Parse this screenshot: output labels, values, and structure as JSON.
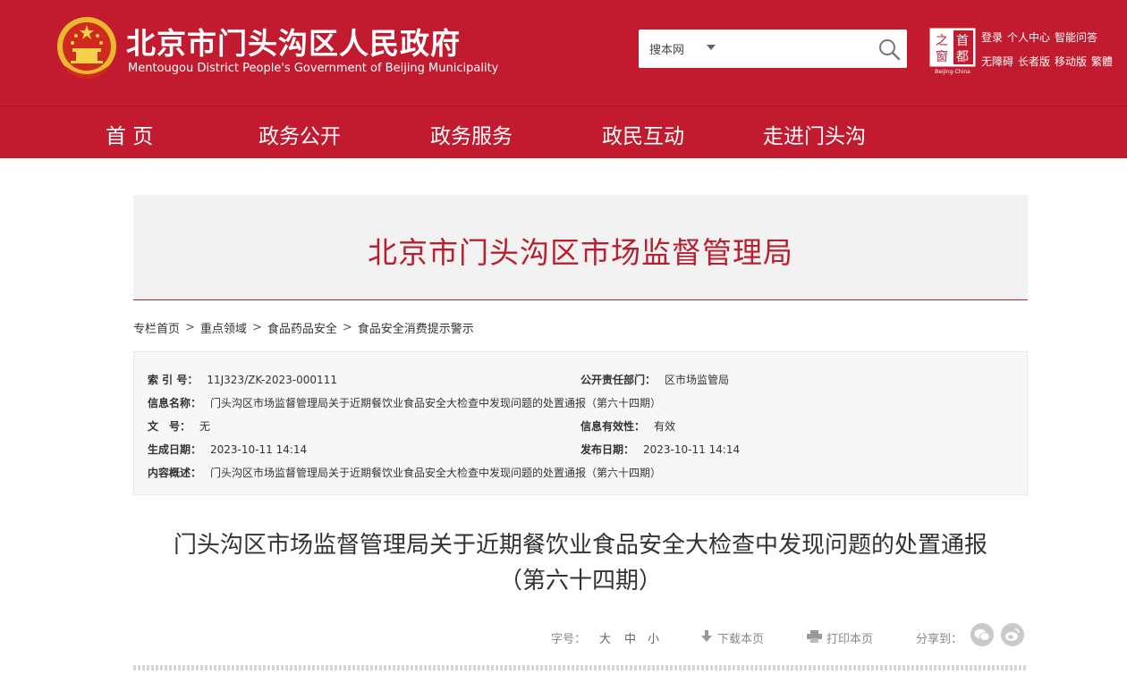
{
  "header": {
    "title": "北京市门头沟区人民政府",
    "subtitle": "Mentougou District People's Government of Beijing Municipality",
    "search": {
      "scope": "搜本网",
      "placeholder": ""
    },
    "capital_logo": {
      "chars": [
        "之",
        "首",
        "窗",
        "都"
      ],
      "caption": "Beijing-China"
    },
    "top_links": {
      "row1": [
        "登录",
        "个人中心",
        "智能问答"
      ],
      "row2": [
        "无障碍",
        "长者版",
        "移动版",
        "繁體"
      ]
    }
  },
  "nav": [
    "首 页",
    "政务公开",
    "政务服务",
    "政民互动",
    "走进门头沟"
  ],
  "department": "北京市门头沟区市场监督管理局",
  "breadcrumb": [
    "专栏首页",
    "重点领域",
    "食品药品安全",
    "食品安全消费提示警示"
  ],
  "breadcrumb_separator": ">",
  "info": {
    "index_label": "索 引 号：",
    "index_value": "11J323/ZK-2023-000111",
    "dept_label": "公开责任部门：",
    "dept_value": "区市场监管局",
    "name_label": "信息名称：",
    "name_value": "门头沟区市场监督管理局关于近期餐饮业食品安全大检查中发现问题的处置通报（第六十四期）",
    "doc_label": "文　号：",
    "doc_value": "无",
    "validity_label": "信息有效性：",
    "validity_value": "有效",
    "created_label": "生成日期：",
    "created_value": "2023-10-11 14:14",
    "published_label": "发布日期：",
    "published_value": "2023-10-11 14:14",
    "summary_label": "内容概述：",
    "summary_value": "门头沟区市场监督管理局关于近期餐饮业食品安全大检查中发现问题的处置通报（第六十四期）"
  },
  "article": {
    "title_line1": "门头沟区市场监督管理局关于近期餐饮业食品安全大检查中发现问题的处置通报",
    "title_line2": "（第六十四期）"
  },
  "tools": {
    "font_label": "字号：",
    "font_large": "大",
    "font_medium": "中",
    "font_small": "小",
    "download": "下载本页",
    "print": "打印本页",
    "share_label": "分享到："
  },
  "colors": {
    "brand_red": "#c21a2e",
    "dept_red": "#b8202f"
  },
  "icons": [
    "search-icon",
    "download-icon",
    "print-icon",
    "wechat-icon",
    "weibo-icon"
  ]
}
